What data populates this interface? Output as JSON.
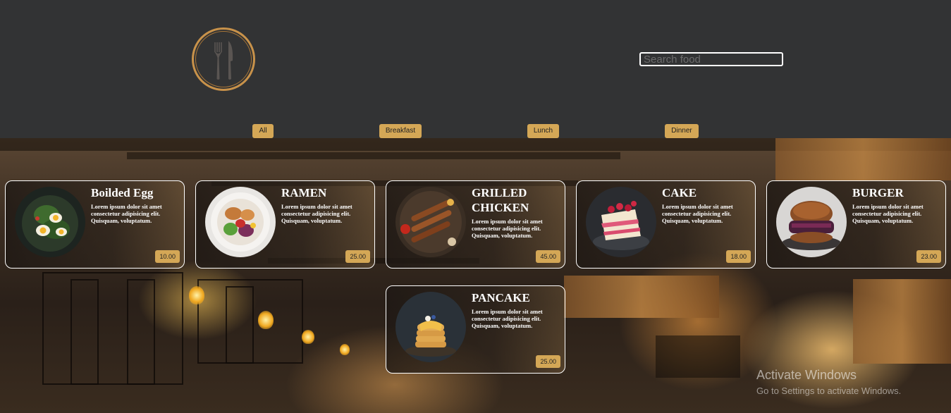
{
  "header": {
    "logo_icon": "fork-and-knife-icon",
    "search": {
      "placeholder": "Search food",
      "value": ""
    }
  },
  "filters": [
    "All",
    "Breakfast",
    "Lunch",
    "Dinner"
  ],
  "accent_color": "#d4a756",
  "menu_items": [
    {
      "title": "Boilded Egg",
      "description": "Lorem ipsum dolor sit amet consectetur adipisicing elit. Quisquam, voluptatum.",
      "price": "10.00"
    },
    {
      "title": "RAMEN",
      "description": "Lorem ipsum dolor sit amet consectetur adipisicing elit. Quisquam, voluptatum.",
      "price": "25.00"
    },
    {
      "title": "GRILLED CHICKEN",
      "description": "Lorem ipsum dolor sit amet consectetur adipisicing elit. Quisquam, voluptatum.",
      "price": "45.00"
    },
    {
      "title": "CAKE",
      "description": "Lorem ipsum dolor sit amet consectetur adipisicing elit. Quisquam, voluptatum.",
      "price": "18.00"
    },
    {
      "title": "BURGER",
      "description": "Lorem ipsum dolor sit amet consectetur adipisicing elit. Quisquam, voluptatum.",
      "price": "23.00"
    },
    {
      "title": "PANCAKE",
      "description": "Lorem ipsum dolor sit amet consectetur adipisicing elit. Quisquam, voluptatum.",
      "price": "25.00"
    }
  ],
  "watermark": {
    "line1": "Activate Windows",
    "line2": "Go to Settings to activate Windows."
  }
}
